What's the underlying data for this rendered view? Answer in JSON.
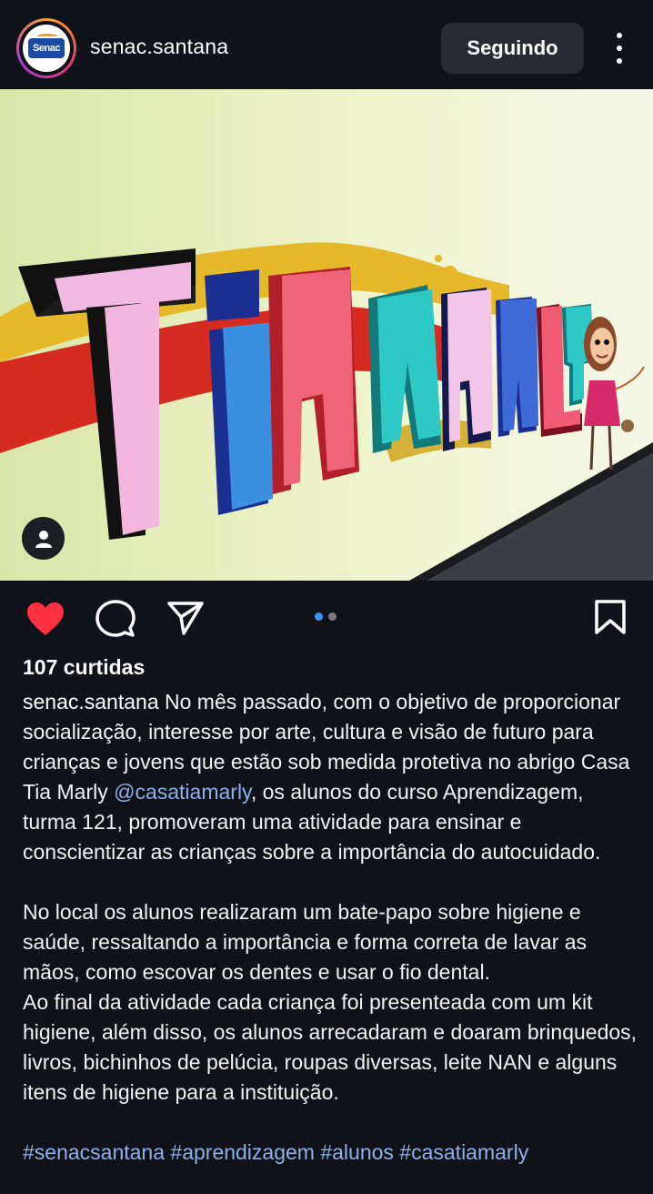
{
  "header": {
    "username": "senac.santana",
    "follow_button": "Seguindo",
    "logo_text": "Senac"
  },
  "post": {
    "mural_text": "TiA MARLY",
    "carousel": {
      "count": 2,
      "active": 0
    },
    "likes": "107 curtidas",
    "caption": {
      "username": "senac.santana",
      "line1": "No mês passado, com o objetivo de proporcionar socialização, interesse por arte, cultura e visão de futuro para crianças e jovens que estão sob medida protetiva no abrigo Casa Tia Marly",
      "mention": "@casatiamarly",
      "line2": ", os alunos do curso Aprendizagem, turma 121, promoveram uma atividade para ensinar e conscientizar as crianças sobre a importância do autocuidado.",
      "paragraph2": "No local os alunos realizaram um bate-papo sobre higiene e saúde, ressaltando a importância e forma correta de lavar as mãos, como escovar os dentes e usar o fio dental.",
      "paragraph3": "Ao final da atividade cada criança foi presenteada com um kit higiene, além disso, os alunos arrecadaram e doaram brinquedos, livros, bichinhos de pelúcia, roupas diversas, leite NAN e alguns itens de higiene para a instituição.",
      "hashtags": "#senacsantana #aprendizagem #alunos #casatiamarly"
    }
  },
  "icons": {
    "like": "heart-icon",
    "comment": "comment-icon",
    "share": "send-icon",
    "save": "bookmark-icon",
    "more": "more-vertical-icon",
    "tag": "user-tag-icon"
  },
  "colors": {
    "background": "#0f1218",
    "heart": "#ff3040",
    "link": "#8fb0e8",
    "dot_active": "#3897f0",
    "dot_inactive": "#7a7a7a"
  }
}
